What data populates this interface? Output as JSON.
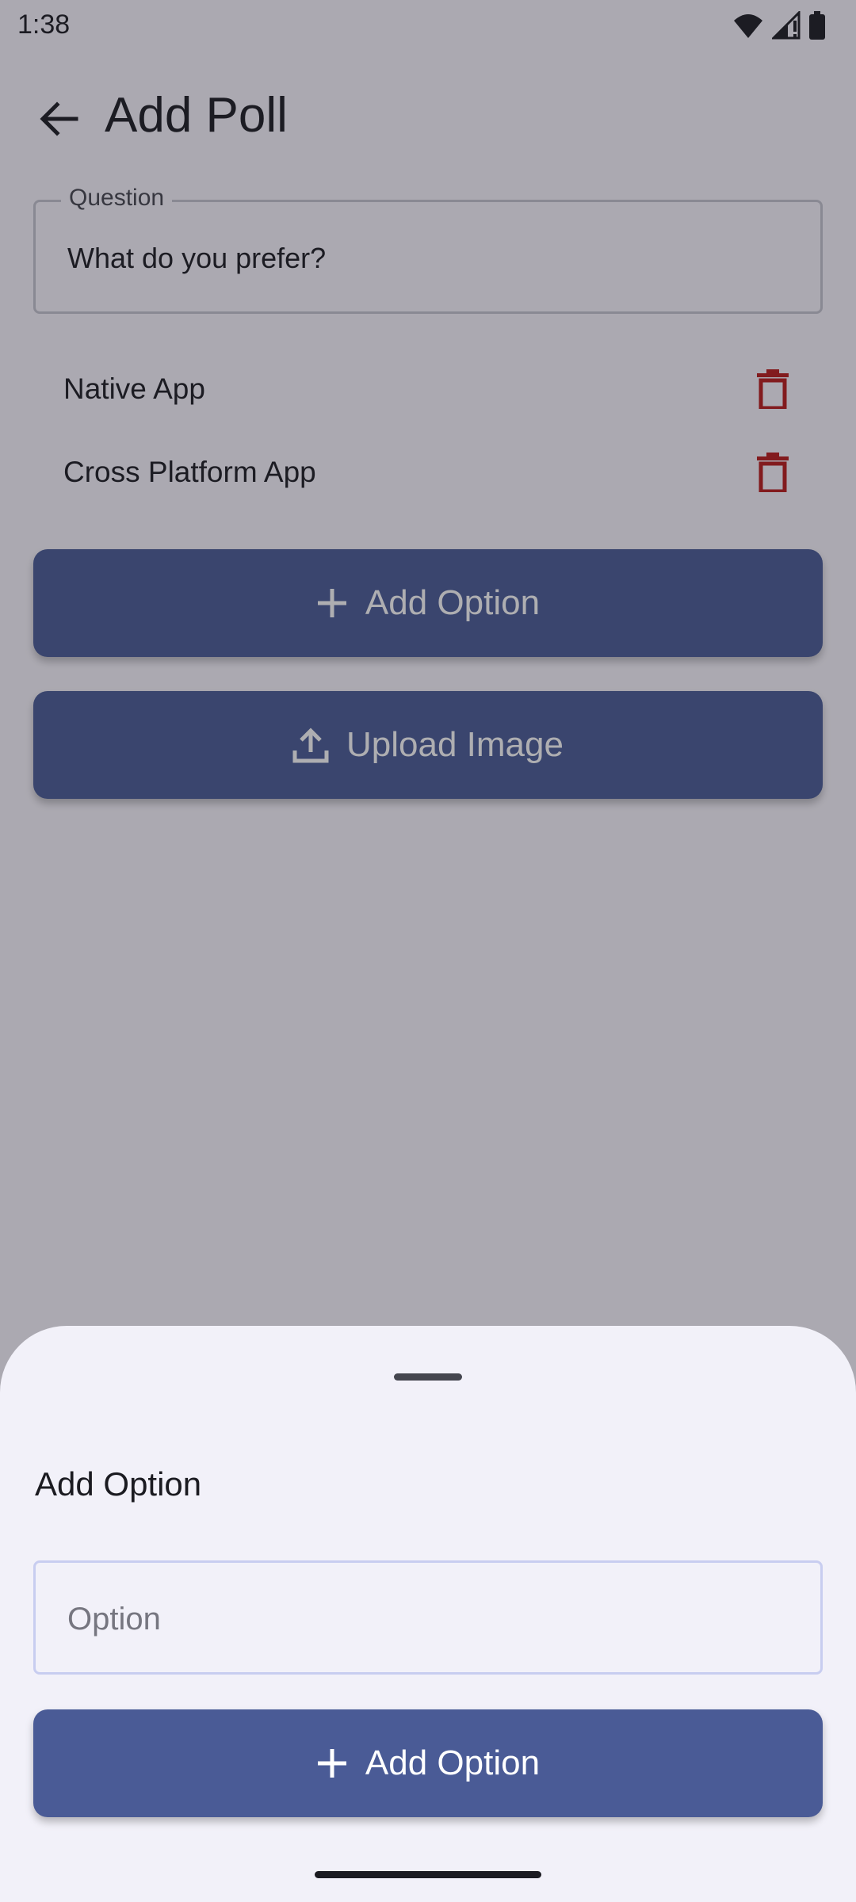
{
  "status_bar": {
    "time": "1:38",
    "icons": [
      "wifi-icon",
      "signal-icon",
      "battery-icon"
    ]
  },
  "app_bar": {
    "title": "Add Poll",
    "back_icon": "arrow-back-icon"
  },
  "question_field": {
    "label": "Question",
    "value": "What do you prefer?"
  },
  "options": [
    {
      "label": "Native App"
    },
    {
      "label": "Cross Platform App"
    }
  ],
  "buttons": {
    "add_option": {
      "label": "Add Option",
      "icon": "plus-icon"
    },
    "upload_image": {
      "label": "Upload Image",
      "icon": "upload-icon"
    }
  },
  "bottom_sheet": {
    "title": "Add Option",
    "input": {
      "placeholder": "Option",
      "value": ""
    },
    "button": {
      "label": "Add Option",
      "icon": "plus-icon"
    }
  },
  "colors": {
    "primary": "#4a5b96",
    "delete": "#ba1a1a",
    "scrim": "rgba(30,30,40,0.36)",
    "sheet_bg": "#f2f1f9"
  }
}
